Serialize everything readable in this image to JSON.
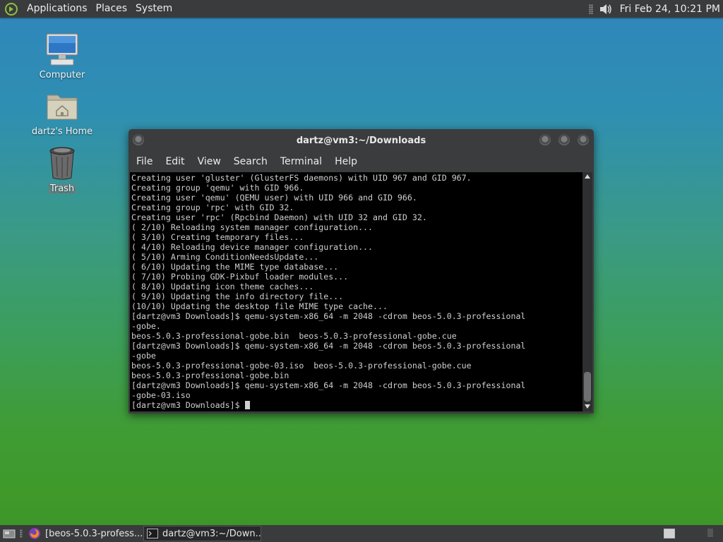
{
  "top_panel": {
    "menus": [
      "Applications",
      "Places",
      "System"
    ],
    "clock": "Fri Feb 24, 10:21 PM"
  },
  "desktop": {
    "icons": [
      {
        "label": "Computer",
        "icon": "computer-icon"
      },
      {
        "label": "dartz's Home",
        "icon": "home-folder-icon"
      },
      {
        "label": "Trash",
        "icon": "trash-icon"
      }
    ]
  },
  "terminal": {
    "title": "dartz@vm3:~/Downloads",
    "menu": [
      "File",
      "Edit",
      "View",
      "Search",
      "Terminal",
      "Help"
    ],
    "lines": [
      "Creating user 'gluster' (GlusterFS daemons) with UID 967 and GID 967.",
      "Creating group 'qemu' with GID 966.",
      "Creating user 'qemu' (QEMU user) with UID 966 and GID 966.",
      "Creating group 'rpc' with GID 32.",
      "Creating user 'rpc' (Rpcbind Daemon) with UID 32 and GID 32.",
      "( 2/10) Reloading system manager configuration...",
      "( 3/10) Creating temporary files...",
      "( 4/10) Reloading device manager configuration...",
      "( 5/10) Arming ConditionNeedsUpdate...",
      "( 6/10) Updating the MIME type database...",
      "( 7/10) Probing GDK-Pixbuf loader modules...",
      "( 8/10) Updating icon theme caches...",
      "( 9/10) Updating the info directory file...",
      "(10/10) Updating the desktop file MIME type cache...",
      "[dartz@vm3 Downloads]$ qemu-system-x86_64 -m 2048 -cdrom beos-5.0.3-professional",
      "-gobe.",
      "beos-5.0.3-professional-gobe.bin  beos-5.0.3-professional-gobe.cue",
      "[dartz@vm3 Downloads]$ qemu-system-x86_64 -m 2048 -cdrom beos-5.0.3-professional",
      "-gobe",
      "beos-5.0.3-professional-gobe-03.iso  beos-5.0.3-professional-gobe.cue",
      "beos-5.0.3-professional-gobe.bin",
      "[dartz@vm3 Downloads]$ qemu-system-x86_64 -m 2048 -cdrom beos-5.0.3-professional",
      "-gobe-03.iso",
      "[dartz@vm3 Downloads]$ "
    ]
  },
  "taskbar": {
    "tasks": [
      {
        "label": "[beos-5.0.3-profess...",
        "icon": "firefox-icon"
      },
      {
        "label": "dartz@vm3:~/Down...",
        "icon": "terminal-icon"
      }
    ]
  },
  "colors": {
    "panel": "#3a3b3d",
    "terminal_bg": "#000000",
    "terminal_fg": "#cfcfcf"
  }
}
